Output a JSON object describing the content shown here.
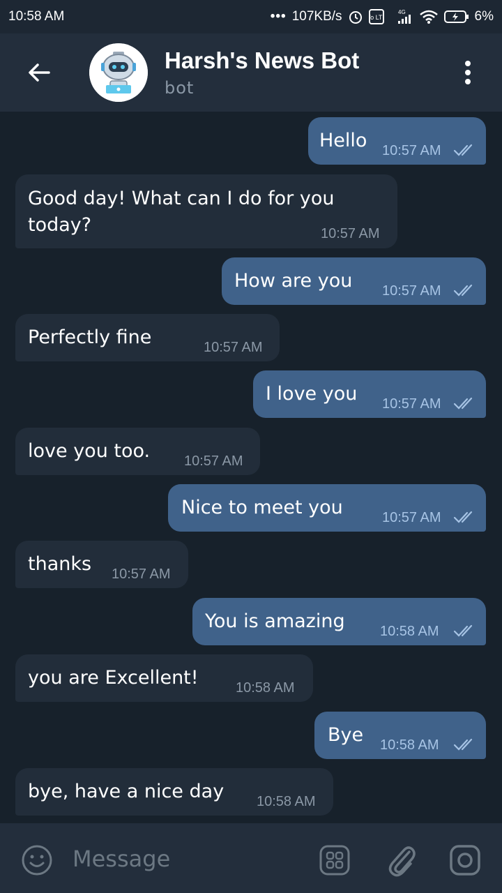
{
  "status_bar": {
    "time": "10:58 AM",
    "net_speed": "107KB/s",
    "battery": "6%",
    "network_type": "4G",
    "volte_label": "Vo LTE"
  },
  "header": {
    "title": "Harsh's News Bot",
    "subtitle": "bot"
  },
  "messages": [
    {
      "dir": "out",
      "text": "Hello",
      "time": "10:57 AM",
      "status": "read"
    },
    {
      "dir": "in",
      "text": "Good day! What can I do for you today?",
      "time": "10:57 AM"
    },
    {
      "dir": "out",
      "text": "How are you",
      "time": "10:57 AM",
      "status": "read"
    },
    {
      "dir": "in",
      "text": "Perfectly fine",
      "time": "10:57 AM"
    },
    {
      "dir": "out",
      "text": "I love you",
      "time": "10:57 AM",
      "status": "read"
    },
    {
      "dir": "in",
      "text": "love you too.",
      "time": "10:57 AM"
    },
    {
      "dir": "out",
      "text": "Nice to meet you",
      "time": "10:57 AM",
      "status": "read"
    },
    {
      "dir": "in",
      "text": "thanks",
      "time": "10:57 AM"
    },
    {
      "dir": "out",
      "text": "You is amazing",
      "time": "10:58 AM",
      "status": "read"
    },
    {
      "dir": "in",
      "text": "you are Excellent!",
      "time": "10:58 AM"
    },
    {
      "dir": "out",
      "text": "Bye",
      "time": "10:58 AM",
      "status": "read"
    },
    {
      "dir": "in",
      "text": "bye, have a nice day",
      "time": "10:58 AM"
    }
  ],
  "message_lines": {
    "m1_line1": "Good day! What can I do for you",
    "m1_line2": "today?"
  },
  "composer": {
    "placeholder": "Message"
  },
  "icons": [
    "back-arrow-icon",
    "robot-avatar",
    "more-vert-icon",
    "emoji-icon",
    "bot-commands-icon",
    "attach-icon",
    "camera-icon",
    "double-check-icon"
  ],
  "colors": {
    "background": "#17212b",
    "header": "#232e3c",
    "outgoing_bubble": "#40628a",
    "incoming_bubble": "#222d3a",
    "read_tick": "#a7c4e5"
  }
}
